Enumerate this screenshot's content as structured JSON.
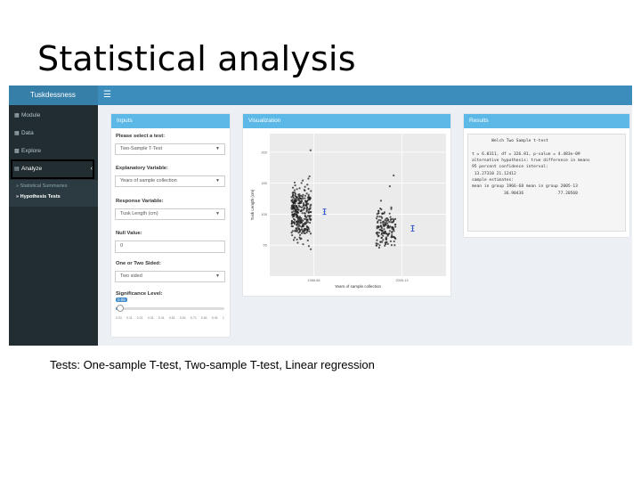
{
  "slide": {
    "title": "Statistical analysis",
    "caption": "Tests: One-sample T-test, Two-sample T-test, Linear regression"
  },
  "app": {
    "brand": "Tuskdessness",
    "menu_icon": "hamburger-icon"
  },
  "sidebar": {
    "items": [
      {
        "label": "Module",
        "icon": "module-icon"
      },
      {
        "label": "Data",
        "icon": "table-icon"
      },
      {
        "label": "Explore",
        "icon": "bar-chart-icon"
      },
      {
        "label": "Analyze",
        "icon": "analyze-icon"
      }
    ],
    "subitems": [
      {
        "label": "Statistical Summaries"
      },
      {
        "label": "Hypothesis Tests"
      }
    ]
  },
  "inputs": {
    "header": "Inputs",
    "test_label": "Please select a test:",
    "test_value": "Two-Sample T-Test",
    "explanatory_label": "Explanatory Variable:",
    "explanatory_value": "Years of sample collection",
    "response_label": "Response Variable:",
    "response_value": "Tusk Length (cm)",
    "null_label": "Null Value:",
    "null_value": "0",
    "sided_label": "One or Two Sided:",
    "sided_value": "Two sided",
    "significance_label": "Significance Level:",
    "significance_value": "0.05",
    "slider_ticks": [
      "0.01",
      "0.11",
      "0.21",
      "0.31",
      "0.41",
      "0.51",
      "0.61",
      "0.71",
      "0.81",
      "0.91",
      "1"
    ]
  },
  "visualization": {
    "header": "Visualization"
  },
  "results": {
    "header": "Results",
    "text": "        Welch Two Sample t-test\n\nt = 6.0311, df = 326.81, p-value = 4.483e-09\nalternative hypothesis: true difference in means\n95 percent confidence interval:\n 13.27310 21.12412\nsample estimates:\nmean in group 1966-68 mean in group 2005-13\n             36.90436              77.20568"
  },
  "chart_data": {
    "type": "scatter",
    "title": "",
    "xlabel": "Years of sample collection",
    "ylabel": "Tusk Length (cm)",
    "categories": [
      "1966-68",
      "2005-13"
    ],
    "yticks": [
      50,
      100,
      150,
      200
    ],
    "ylim": [
      0,
      230
    ],
    "group_means": [
      104,
      77
    ],
    "group_ranges": [
      [
        20,
        215
      ],
      [
        25,
        170
      ]
    ],
    "point_counts": [
      320,
      150
    ],
    "point_color": "#222222",
    "mean_marker_color": "#3355cc"
  }
}
